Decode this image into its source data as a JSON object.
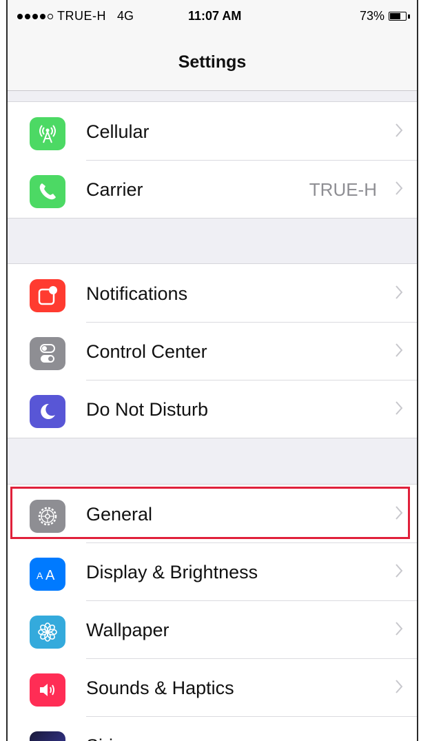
{
  "status_bar": {
    "carrier": "TRUE-H",
    "network": "4G",
    "time": "11:07 AM",
    "battery": "73%",
    "battery_level": 0.73
  },
  "nav": {
    "title": "Settings"
  },
  "groups": [
    {
      "items": [
        {
          "label": "Cellular",
          "icon": "cellular-antenna-icon",
          "color": "#4cd964"
        },
        {
          "label": "Carrier",
          "value": "TRUE-H",
          "icon": "phone-icon",
          "color": "#4cd964"
        }
      ]
    },
    {
      "items": [
        {
          "label": "Notifications",
          "icon": "notifications-icon",
          "color": "#ff3b30"
        },
        {
          "label": "Control Center",
          "icon": "toggle-switches-icon",
          "color": "#8e8e93"
        },
        {
          "label": "Do Not Disturb",
          "icon": "moon-icon",
          "color": "#5856d6"
        }
      ]
    },
    {
      "items": [
        {
          "label": "General",
          "icon": "gear-icon",
          "color": "#8e8e93",
          "highlighted": true
        },
        {
          "label": "Display & Brightness",
          "icon": "text-size-aa-icon",
          "color": "#007aff"
        },
        {
          "label": "Wallpaper",
          "icon": "flower-icon",
          "color": "#34aadc"
        },
        {
          "label": "Sounds & Haptics",
          "icon": "speaker-icon",
          "color": "#ff2d55"
        },
        {
          "label": "Siri",
          "icon": "siri-icon",
          "color": "#1a1a3a"
        }
      ]
    }
  ],
  "annotation": {
    "color": "#e0203a"
  }
}
